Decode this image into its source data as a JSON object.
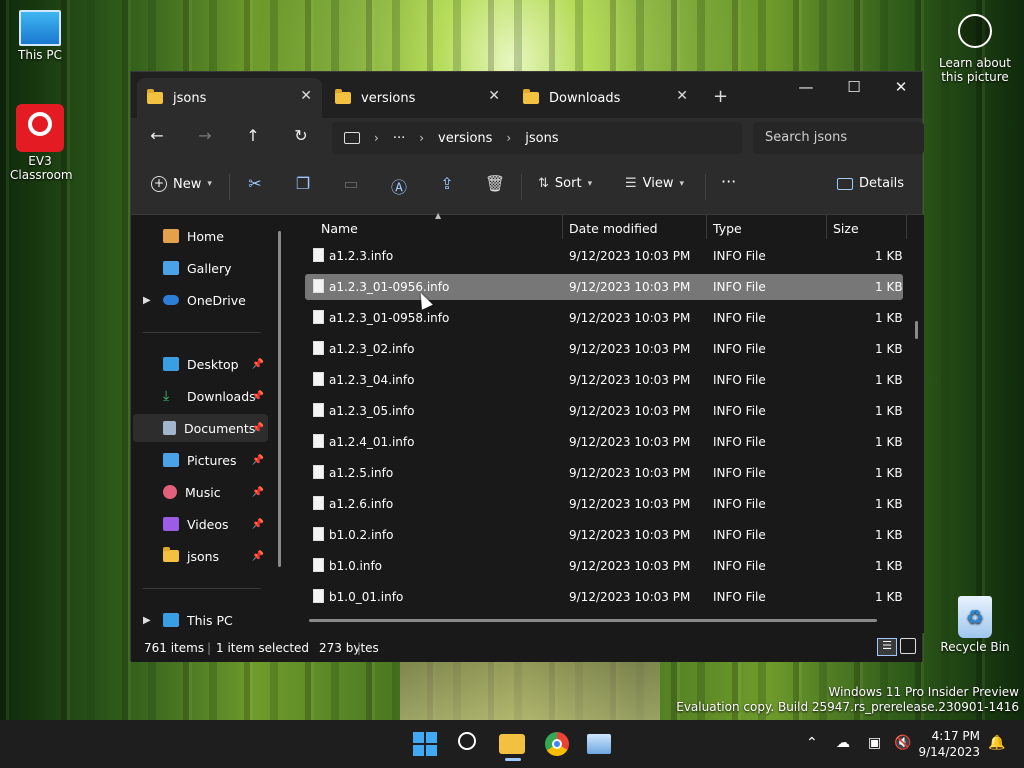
{
  "desktop": {
    "icons": [
      {
        "label": "This PC"
      },
      {
        "label": "EV3 Classroom"
      },
      {
        "label": "Recycle Bin"
      }
    ],
    "learn": "Learn about this picture",
    "watermark_line1": "Windows 11 Pro Insider Preview",
    "watermark_line2": "Evaluation copy. Build 25947.rs_prerelease.230901-1416"
  },
  "explorer": {
    "tabs": [
      {
        "label": "jsons",
        "close": "✕"
      },
      {
        "label": "versions",
        "close": "✕"
      },
      {
        "label": "Downloads",
        "close": "✕"
      }
    ],
    "new_tab": "+",
    "window_controls": {
      "minimize": "—",
      "maximize": "☐",
      "close": "✕"
    },
    "nav": {
      "back": "←",
      "forward": "→",
      "up": "↑",
      "refresh": "↻"
    },
    "address": {
      "more": "···",
      "crumb1": "versions",
      "crumb2": "jsons",
      "sep": "›"
    },
    "search_placeholder": "Search jsons",
    "command_bar": {
      "new": "New",
      "sort": "Sort",
      "view": "View",
      "more": "···",
      "details": "Details"
    },
    "nav_pane": {
      "items": [
        {
          "label": "Home"
        },
        {
          "label": "Gallery"
        },
        {
          "label": "OneDrive"
        },
        {
          "label": "Desktop"
        },
        {
          "label": "Downloads"
        },
        {
          "label": "Documents"
        },
        {
          "label": "Pictures"
        },
        {
          "label": "Music"
        },
        {
          "label": "Videos"
        },
        {
          "label": "jsons"
        },
        {
          "label": "This PC"
        }
      ]
    },
    "columns": {
      "name": "Name",
      "date": "Date modified",
      "type": "Type",
      "size": "Size"
    },
    "files": [
      {
        "name": "a1.2.3.info",
        "date": "9/12/2023 10:03 PM",
        "type": "INFO File",
        "size": "1 KB"
      },
      {
        "name": "a1.2.3_01-0956.info",
        "date": "9/12/2023 10:03 PM",
        "type": "INFO File",
        "size": "1 KB"
      },
      {
        "name": "a1.2.3_01-0958.info",
        "date": "9/12/2023 10:03 PM",
        "type": "INFO File",
        "size": "1 KB"
      },
      {
        "name": "a1.2.3_02.info",
        "date": "9/12/2023 10:03 PM",
        "type": "INFO File",
        "size": "1 KB"
      },
      {
        "name": "a1.2.3_04.info",
        "date": "9/12/2023 10:03 PM",
        "type": "INFO File",
        "size": "1 KB"
      },
      {
        "name": "a1.2.3_05.info",
        "date": "9/12/2023 10:03 PM",
        "type": "INFO File",
        "size": "1 KB"
      },
      {
        "name": "a1.2.4_01.info",
        "date": "9/12/2023 10:03 PM",
        "type": "INFO File",
        "size": "1 KB"
      },
      {
        "name": "a1.2.5.info",
        "date": "9/12/2023 10:03 PM",
        "type": "INFO File",
        "size": "1 KB"
      },
      {
        "name": "a1.2.6.info",
        "date": "9/12/2023 10:03 PM",
        "type": "INFO File",
        "size": "1 KB"
      },
      {
        "name": "b1.0.2.info",
        "date": "9/12/2023 10:03 PM",
        "type": "INFO File",
        "size": "1 KB"
      },
      {
        "name": "b1.0.info",
        "date": "9/12/2023 10:03 PM",
        "type": "INFO File",
        "size": "1 KB"
      },
      {
        "name": "b1.0_01.info",
        "date": "9/12/2023 10:03 PM",
        "type": "INFO File",
        "size": "1 KB"
      }
    ],
    "status": {
      "count": "761 items",
      "selected": "1 item selected",
      "bytes": "273 bytes"
    }
  },
  "taskbar": {
    "time": "4:17 PM",
    "date": "9/14/2023"
  }
}
